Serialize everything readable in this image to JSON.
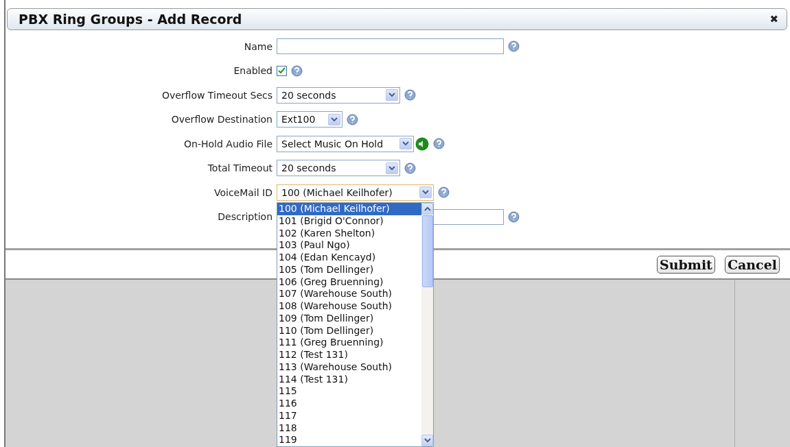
{
  "window": {
    "title": "PBX Ring Groups - Add Record",
    "close": "✖"
  },
  "fields": [
    {
      "kind": "text",
      "label": "Name"
    },
    {
      "kind": "checkbox",
      "label": "Enabled",
      "checked": true
    },
    {
      "kind": "select",
      "label": "Overflow Timeout Secs",
      "value": "20 seconds"
    },
    {
      "kind": "select",
      "label": "Overflow Destination",
      "value": "Ext100"
    },
    {
      "kind": "audio",
      "label": "On-Hold Audio File",
      "value": "Select Music On Hold"
    },
    {
      "kind": "select",
      "label": "Total Timeout",
      "value": "20 seconds"
    },
    {
      "kind": "select",
      "label": "VoiceMail ID",
      "value": "100 (Michael Keilhofer)",
      "expanded": true
    },
    {
      "kind": "text",
      "label": "Description"
    }
  ],
  "voicemail_options": [
    {
      "label": "100 (Michael Keilhofer)",
      "selected": true
    },
    {
      "label": "101 (Brigid O'Connor)",
      "selected": false
    },
    {
      "label": "102 (Karen Shelton)",
      "selected": false
    },
    {
      "label": "103 (Paul Ngo)",
      "selected": false
    },
    {
      "label": "104 (Edan Kencayd)",
      "selected": false
    },
    {
      "label": "105 (Tom Dellinger)",
      "selected": false
    },
    {
      "label": "106 (Greg Bruenning)",
      "selected": false
    },
    {
      "label": "107 (Warehouse South)",
      "selected": false
    },
    {
      "label": "108 (Warehouse South)",
      "selected": false
    },
    {
      "label": "109 (Tom Dellinger)",
      "selected": false
    },
    {
      "label": "110 (Tom Dellinger)",
      "selected": false
    },
    {
      "label": "111 (Greg Bruenning)",
      "selected": false
    },
    {
      "label": "112 (Test 131)",
      "selected": false
    },
    {
      "label": "113 (Warehouse South)",
      "selected": false
    },
    {
      "label": "114 (Test 131)",
      "selected": false
    },
    {
      "label": "115",
      "selected": false
    },
    {
      "label": "116",
      "selected": false
    },
    {
      "label": "117",
      "selected": false
    },
    {
      "label": "118",
      "selected": false
    },
    {
      "label": "119",
      "selected": false
    }
  ],
  "buttons": [
    "Submit",
    "Cancel"
  ]
}
